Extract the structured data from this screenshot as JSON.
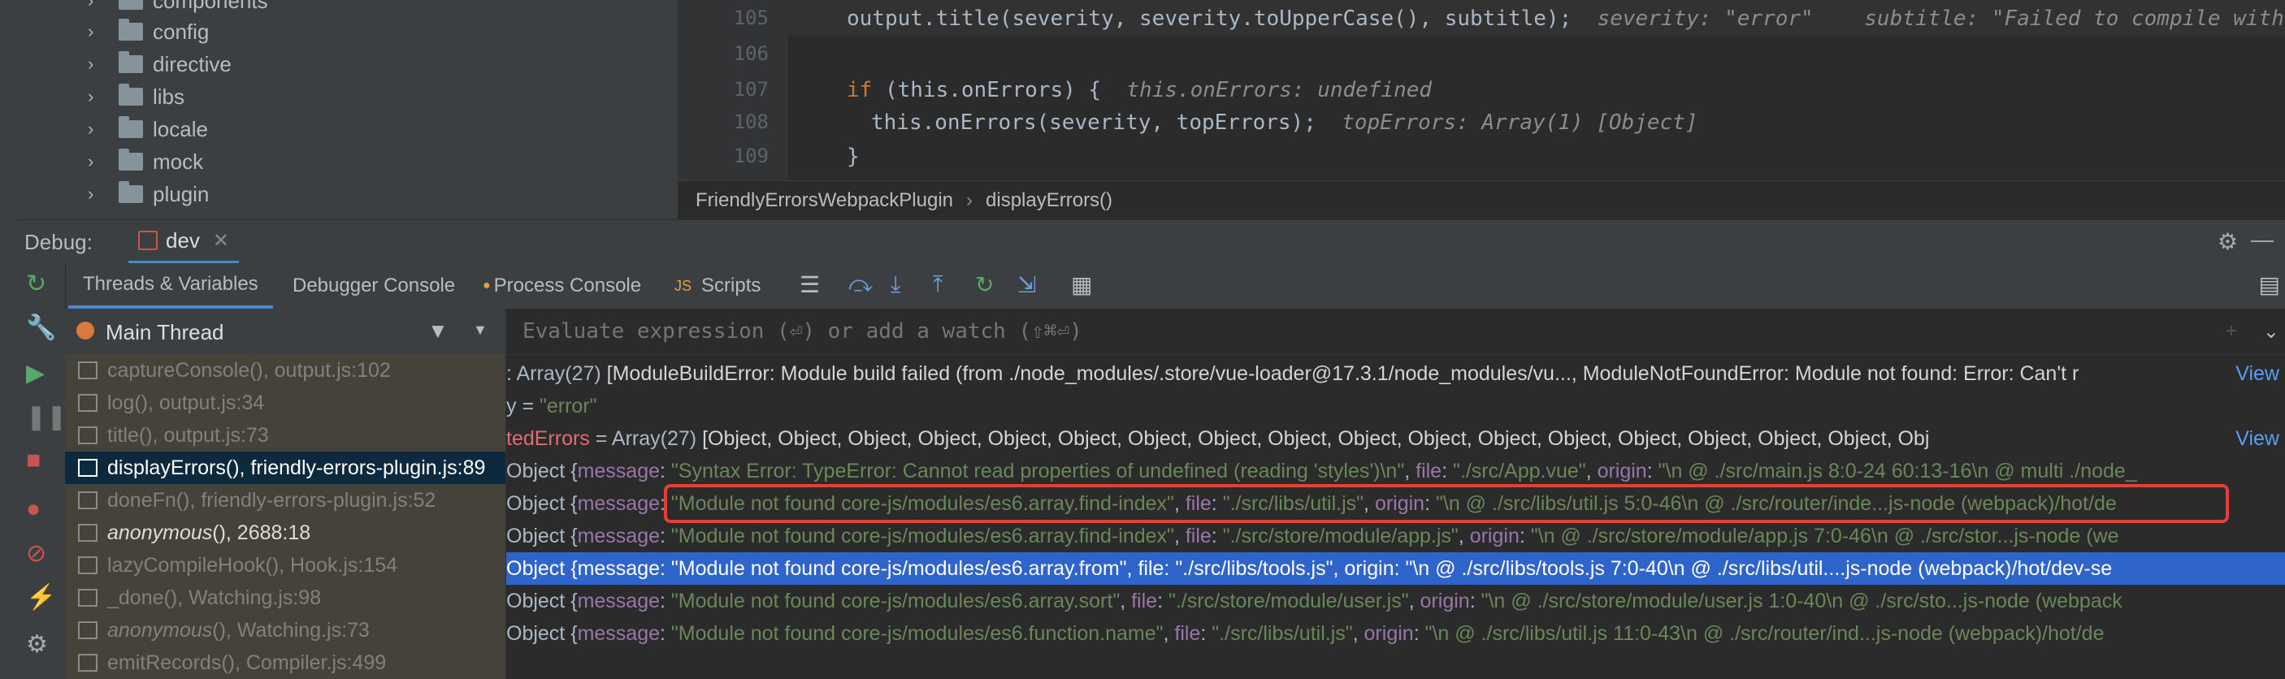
{
  "project_tree": {
    "items": [
      {
        "label": "components"
      },
      {
        "label": "config"
      },
      {
        "label": "directive"
      },
      {
        "label": "libs"
      },
      {
        "label": "locale"
      },
      {
        "label": "mock"
      },
      {
        "label": "plugin"
      }
    ]
  },
  "editor": {
    "lines": [
      {
        "num": "105",
        "code": "output.title(severity, severity.toUpperCase(), subtitle);",
        "hint": "severity: \"error\"    subtitle: \"Failed to compile with"
      },
      {
        "num": "106",
        "code": "",
        "hint": ""
      },
      {
        "num": "107",
        "code_kw": "if",
        "code": " (this.onErrors) {",
        "hint": "this.onErrors: undefined"
      },
      {
        "num": "108",
        "code": "this.onErrors(severity, topErrors);",
        "hint": "topErrors: Array(1) [Object]"
      },
      {
        "num": "109",
        "code": "}",
        "hint": ""
      }
    ],
    "breadcrumb": [
      "FriendlyErrorsWebpackPlugin",
      "displayErrors()"
    ]
  },
  "debug": {
    "label": "Debug:",
    "session_tab": "dev",
    "tabs": [
      "Threads & Variables",
      "Debugger Console",
      "Process Console",
      "Scripts"
    ],
    "thread": "Main Thread",
    "watch_placeholder": "Evaluate expression (⏎) or add a watch (⇧⌘⏎)"
  },
  "frames": [
    {
      "name": "captureConsole(), output.js:102",
      "style": "normal"
    },
    {
      "name": "log(), output.js:34",
      "style": "normal"
    },
    {
      "name": "title(), output.js:73",
      "style": "normal"
    },
    {
      "name": "displayErrors(), friendly-errors-plugin.js:89",
      "style": "selected"
    },
    {
      "name": "doneFn(), friendly-errors-plugin.js:52",
      "style": "normal"
    },
    {
      "name_italic": "anonymous",
      "name": "(), 2688:18",
      "style": "bright"
    },
    {
      "name": "lazyCompileHook(), Hook.js:154",
      "style": "normal"
    },
    {
      "name": "_done(), Watching.js:98",
      "style": "normal"
    },
    {
      "name_italic": "anonymous",
      "name": "(), Watching.js:73",
      "style": "normal"
    },
    {
      "name": "emitRecords(), Compiler.js:499",
      "style": "normal"
    }
  ],
  "variables": {
    "line1_prefix": ": Array(27) ",
    "line1_text": "[ModuleBuildError: Module build failed (from ./node_modules/.store/vue-loader@17.3.1/node_modules/vu..., ModuleNotFoundError: Module not found: Error: Can't r",
    "line1_link": "View",
    "line2_prefix": "y = ",
    "line2_value": "\"error\"",
    "line3_name": "tedErrors",
    "line3_type": " = Array(27) ",
    "line3_text": "[Object, Object, Object, Object, Object, Object, Object, Object, Object, Object, Object, Object, Object, Object, Object, Object, Object, Obj",
    "line3_link": "View",
    "rows": [
      {
        "message": "\"Syntax Error: TypeError: Cannot read properties of undefined (reading 'styles')\\n\"",
        "file": "\"./src/App.vue\"",
        "origin": "\"\\n @ ./src/main.js 8:0-24 60:13-16\\n @ multi ./node_"
      },
      {
        "message": "\"Module not found core-js/modules/es6.array.find-index\"",
        "file": "\"./src/libs/util.js\"",
        "origin": "\"\\n @ ./src/libs/util.js 5:0-46\\n @ ./src/router/inde...js-node (webpack)/hot/de"
      },
      {
        "message": "\"Module not found core-js/modules/es6.array.find-index\"",
        "file": "\"./src/store/module/app.js\"",
        "origin": "\"\\n @ ./src/store/module/app.js 7:0-46\\n @ ./src/stor...js-node (we"
      },
      {
        "message": "\"Module not found core-js/modules/es6.array.from\"",
        "file": "\"./src/libs/tools.js\"",
        "origin": "\"\\n @ ./src/libs/tools.js 7:0-40\\n @ ./src/libs/util....js-node (webpack)/hot/dev-se"
      },
      {
        "message": "\"Module not found core-js/modules/es6.array.sort\"",
        "file": "\"./src/store/module/user.js\"",
        "origin": "\"\\n @ ./src/store/module/user.js 1:0-40\\n @ ./src/sto...js-node (webpack"
      },
      {
        "message": "\"Module not found core-js/modules/es6.function.name\"",
        "file": "\"./src/libs/util.js\"",
        "origin": "\"\\n @ ./src/libs/util.js 11:0-43\\n @ ./src/router/ind...js-node (webpack)/hot/de"
      }
    ],
    "row_prefix": "Object {",
    "key_message": "message",
    "key_file": "file",
    "key_origin": "origin"
  },
  "colors": {
    "accent": "#4a88c7",
    "selection": "#2f65ca",
    "highlight": "#e0423a"
  }
}
